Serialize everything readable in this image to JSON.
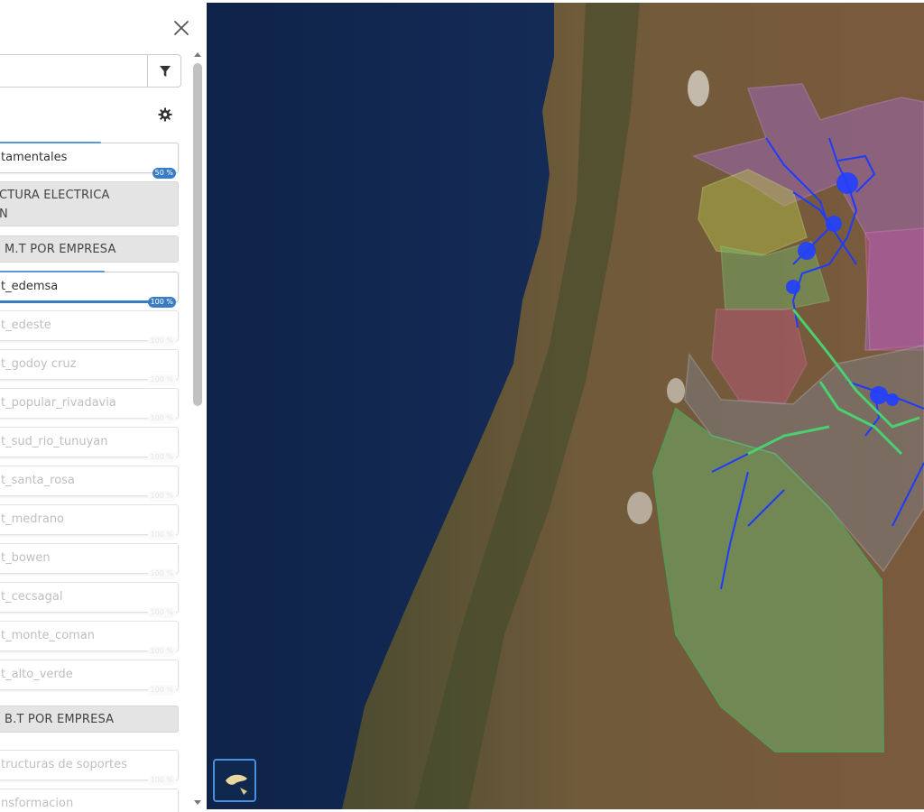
{
  "panel": {
    "search": {
      "value": "",
      "placeholder": ""
    },
    "layers": [
      {
        "label": "tamentales",
        "kind": "layer",
        "active": true,
        "progress_percent": 50,
        "progress_label": "50 %"
      },
      {
        "label": "CTURA ELECTRICA",
        "label2": "N",
        "kind": "group"
      },
      {
        "label": "M.T POR EMPRESA",
        "kind": "group"
      },
      {
        "label": "t_edemsa",
        "kind": "layer",
        "active": true,
        "progress_percent": 100,
        "progress_label": "100 %"
      },
      {
        "label": "t_edeste",
        "kind": "layer",
        "active": false,
        "progress_label": "100 %"
      },
      {
        "label": "t_godoy cruz",
        "kind": "layer",
        "active": false,
        "progress_label": "100 %"
      },
      {
        "label": "t_popular_rivadavia",
        "kind": "layer",
        "active": false,
        "progress_label": "100 %"
      },
      {
        "label": "t_sud_rio_tunuyan",
        "kind": "layer",
        "active": false,
        "progress_label": "100 %"
      },
      {
        "label": "t_santa_rosa",
        "kind": "layer",
        "active": false,
        "progress_label": "100 %"
      },
      {
        "label": "t_medrano",
        "kind": "layer",
        "active": false,
        "progress_label": "100 %"
      },
      {
        "label": "t_bowen",
        "kind": "layer",
        "active": false,
        "progress_label": "100 %"
      },
      {
        "label": "t_cecsagal",
        "kind": "layer",
        "active": false,
        "progress_label": "100 %"
      },
      {
        "label": "t_monte_coman",
        "kind": "layer",
        "active": false,
        "progress_label": "100 %"
      },
      {
        "label": "t_alto_verde",
        "kind": "layer",
        "active": false,
        "progress_label": "100 %"
      },
      {
        "label": "B.T POR EMPRESA",
        "kind": "group"
      },
      {
        "label": "tructuras de soportes",
        "kind": "layer",
        "active": false,
        "progress_label": "100 %"
      },
      {
        "label": "nsformacion",
        "kind": "layer",
        "active": false,
        "progress_label": ""
      }
    ]
  },
  "icons": {
    "close": "close-icon",
    "filter": "filter-icon",
    "settings": "gear-icon",
    "basemap": "basemap-thumbnail-icon"
  },
  "colors": {
    "accent": "#3a7cc4",
    "ocean": "#142a52",
    "land": "#6b5a3e",
    "lines": "#1f3bff"
  }
}
